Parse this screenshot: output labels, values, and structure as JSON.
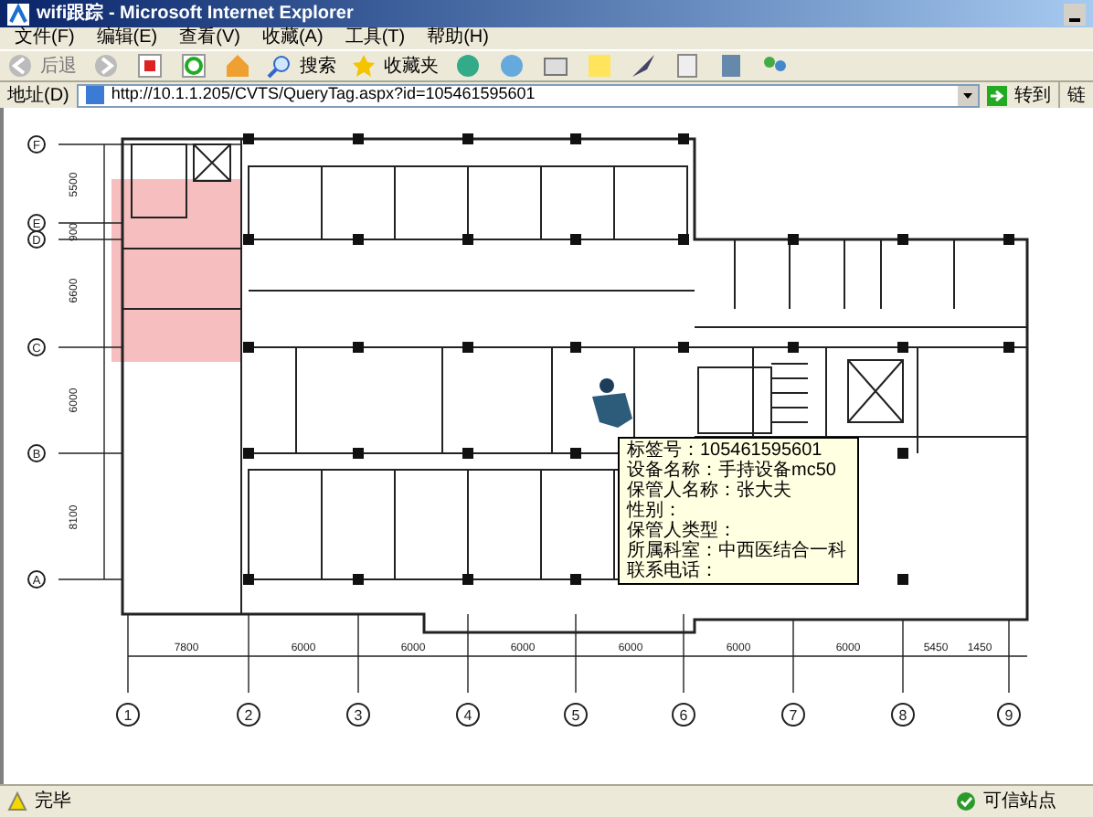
{
  "window": {
    "title": "wifi跟踪 - Microsoft Internet Explorer"
  },
  "menu": [
    {
      "label": "文件(F)"
    },
    {
      "label": "编辑(E)"
    },
    {
      "label": "查看(V)"
    },
    {
      "label": "收藏(A)"
    },
    {
      "label": "工具(T)"
    },
    {
      "label": "帮助(H)"
    }
  ],
  "toolbar": {
    "back": "后退",
    "search": "搜索",
    "favorites": "收藏夹"
  },
  "address_bar": {
    "label": "地址(D)",
    "url": "http://10.1.1.205/CVTS/QueryTag.aspx?id=105461595601",
    "go": "转到",
    "links": "链"
  },
  "floor_plan": {
    "row_axes": [
      "F",
      "E",
      "D",
      "C",
      "B",
      "A"
    ],
    "row_dimensions": [
      "5500",
      "900",
      "6600",
      "6000",
      "8100"
    ],
    "column_axes": [
      "1",
      "2",
      "3",
      "4",
      "5",
      "6",
      "7",
      "8",
      "9"
    ],
    "column_dimensions": [
      "7800",
      "6000",
      "6000",
      "6000",
      "6000",
      "6000",
      "6000",
      "5450",
      "1450"
    ]
  },
  "tag_tooltip": {
    "lines": [
      "标签号：105461595601",
      "设备名称：手持设备mc50",
      "保管人名称：张大夫",
      "性别：",
      "保管人类型：",
      "所属科室：中西医结合一科",
      "联系电话："
    ]
  },
  "status_bar": {
    "text": "完毕",
    "zone": "可信站点"
  }
}
